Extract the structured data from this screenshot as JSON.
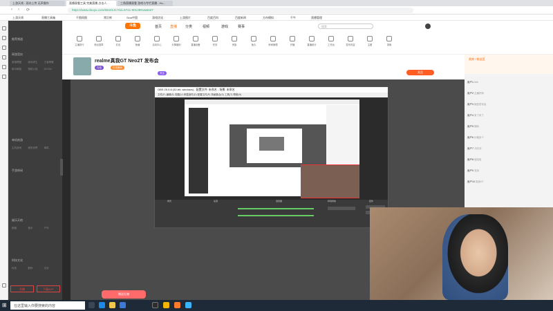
{
  "browser": {
    "tabs": [
      "上游天线 - 双向上传 无声操作",
      "直播观看工具 完美直播 点击人...",
      "三角直播观看 游戏与专栏直播 - Ho..."
    ],
    "url": "https://www.douyu.com/6524141?rid=6741-9013991&&527",
    "bookmarks": [
      "上游天线",
      "直播工具箱",
      "千图网图",
      "常识库",
      "Sina中国",
      "游戏优化",
      "上游图片",
      "百度百科",
      "百度新闻",
      "方舟模拟",
      "千牛",
      "直播管理"
    ]
  },
  "site": {
    "logo": "斗鱼",
    "menu": [
      "首页",
      "直播",
      "分类",
      "视频",
      "游戏",
      "赛事"
    ],
    "search_placeholder": "搜索",
    "features": [
      "主播排行",
      "粉丝勋章",
      "红包",
      "鱼塘",
      "活动中心",
      "天降福利",
      "直播设备",
      "任务",
      "贵族",
      "鱼丸",
      "房间管理",
      "开播",
      "直播统计",
      "工作台",
      "发布内容",
      "主题",
      "录像"
    ]
  },
  "nav": {
    "sections": [
      "推荐频道",
      "网游竞技",
      "单机热游",
      "手游休闲",
      "娱乐天地",
      "科技文化"
    ],
    "items": [
      "英雄联盟",
      "绝地求生",
      "王者荣耀",
      "和平精英",
      "穿越火线",
      "DOTA2",
      "主机游戏",
      "我的世界",
      "单机",
      "颜值",
      "音乐",
      "户外",
      "科技",
      "数码",
      "文化"
    ],
    "footer": [
      "开播",
      "下载APP"
    ]
  },
  "room": {
    "title": "realme真我GT Neo2T 发布会",
    "tags": [
      "在线",
      "科技数码",
      "关注"
    ],
    "follow": "关注"
  },
  "obs": {
    "title": "OBS 25.0.8 (32-bit, windows) - 配置文件: 未命名 - 场景: 未命名",
    "menu": [
      "文件(F)",
      "编辑(E)",
      "视图(V)",
      "停靠部件(D)",
      "配置文件(P)",
      "场景集合(S)",
      "工具(T)",
      "帮助(H)"
    ],
    "docks": [
      "场景",
      "来源",
      "混音器",
      "转场特效",
      "控件"
    ]
  },
  "chat": {
    "rank_title": "贵宾 / 粉丝团",
    "rows": [
      {
        "user": "用户1",
        "msg": "666"
      },
      {
        "user": "用户2",
        "msg": "主播好帅"
      },
      {
        "user": "用户3",
        "msg": "新品发布会"
      },
      {
        "user": "用户4",
        "msg": "来了来了"
      },
      {
        "user": "用户5",
        "msg": "期待"
      },
      {
        "user": "用户6",
        "msg": "价格多少"
      },
      {
        "user": "用户7",
        "msg": "冲冲冲"
      },
      {
        "user": "用户8",
        "msg": "哈哈哈"
      },
      {
        "user": "用户9",
        "msg": "支持"
      },
      {
        "user": "用户10",
        "msg": "真我GT"
      }
    ]
  },
  "gift_button": "赠送礼物",
  "taskbar": {
    "search_placeholder": "在这里输入你要搜索的内容",
    "icons": [
      "task-view-icon",
      "edge-icon",
      "explorer-icon",
      "store-icon",
      "obs-icon",
      "chrome-icon",
      "douyu-icon"
    ]
  },
  "colors": {
    "accent": "#ff7300",
    "follow": "#ff5d23",
    "taskbar": "#1f2a38"
  }
}
